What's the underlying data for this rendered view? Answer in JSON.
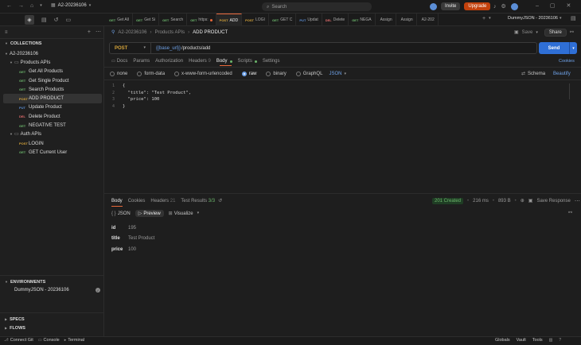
{
  "topbar": {
    "search": "Search",
    "invite": "Invite",
    "upgrade": "Upgrade",
    "workspace": "A2-20236106"
  },
  "tabs": [
    {
      "method": "GET",
      "name": "Get All"
    },
    {
      "method": "GET",
      "name": "Get Si"
    },
    {
      "method": "GET",
      "name": "Search"
    },
    {
      "method": "GET",
      "name": "https:"
    },
    {
      "method": "POST",
      "name": "ADD"
    },
    {
      "method": "POST",
      "name": "LOGI"
    },
    {
      "method": "GET",
      "name": "GET C"
    },
    {
      "method": "PUT",
      "name": "Updat"
    },
    {
      "method": "DEL",
      "name": "Delete"
    },
    {
      "method": "GET",
      "name": "NEGA"
    },
    {
      "method": "",
      "name": "Assign"
    },
    {
      "method": "",
      "name": "Assign"
    },
    {
      "method": "",
      "name": "A2-202"
    }
  ],
  "environment": "DummyJSON - 20236106",
  "sidebar": {
    "collections_label": "COLLECTIONS",
    "collection": "A2-20236106",
    "folder_products": "Products APIs",
    "items_products": [
      {
        "method": "GET",
        "name": "Get All Products"
      },
      {
        "method": "GET",
        "name": "Get Single Product"
      },
      {
        "method": "GET",
        "name": "Search Products"
      },
      {
        "method": "POST",
        "name": "ADD PRODUCT"
      },
      {
        "method": "PUT",
        "name": "Update Product"
      },
      {
        "method": "DEL",
        "name": "Delete Product"
      },
      {
        "method": "GET",
        "name": "NEGATIVE TEST"
      }
    ],
    "folder_auth": "Auth APIs",
    "items_auth": [
      {
        "method": "POST",
        "name": "LOGIN"
      },
      {
        "method": "GET",
        "name": "GET Current User"
      }
    ],
    "environments_label": "ENVIRONMENTS",
    "environment_item": "DummyJSON - 20236106",
    "specs_label": "SPECS",
    "flows_label": "FLOWS"
  },
  "breadcrumb": {
    "collection": "A2-20236106",
    "folder": "Products APIs",
    "request": "ADD PRODUCT"
  },
  "actions": {
    "save": "Save",
    "share": "Share"
  },
  "request": {
    "method": "POST",
    "url_var": "{{base_url}}",
    "url_path": "/products/add",
    "send": "Send",
    "cookies": "Cookies"
  },
  "request_tabs": {
    "docs": "Docs",
    "params": "Params",
    "authorization": "Authorization",
    "headers": "Headers",
    "headers_count": "9",
    "body": "Body",
    "scripts": "Scripts",
    "settings": "Settings"
  },
  "body_types": {
    "none": "none",
    "form_data": "form-data",
    "urlencoded": "x-www-form-urlencoded",
    "raw": "raw",
    "binary": "binary",
    "graphql": "GraphQL",
    "format": "JSON",
    "schema": "Schema",
    "beautify": "Beautify"
  },
  "code": [
    {
      "n": "1",
      "text": "{"
    },
    {
      "n": "2",
      "text": "  \"title\": \"Test Product\","
    },
    {
      "n": "3",
      "text": "  \"price\": 100"
    },
    {
      "n": "4",
      "text": "}"
    }
  ],
  "response": {
    "tabs": {
      "body": "Body",
      "cookies": "Cookies",
      "headers": "Headers",
      "headers_count": "21",
      "tests": "Test Results",
      "tests_count": "3/3"
    },
    "status": "201 Created",
    "time": "216 ms",
    "size": "893 B",
    "save": "Save Response",
    "view": {
      "json": "JSON",
      "preview": "Preview",
      "visualize": "Visualize"
    },
    "fields": [
      {
        "key": "id",
        "value": "195"
      },
      {
        "key": "title",
        "value": "Test Product"
      },
      {
        "key": "price",
        "value": "100"
      }
    ]
  },
  "status": {
    "connect_git": "Connect Git",
    "console": "Console",
    "terminal": "Terminal",
    "globals": "Globals",
    "vault": "Vault",
    "tools": "Tools"
  }
}
